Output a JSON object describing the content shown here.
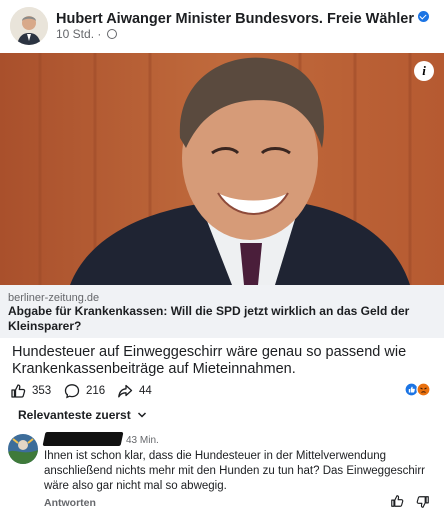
{
  "post": {
    "author": "Hubert Aiwanger Minister Bundesvors. Freie Wähler",
    "time": "10 Std.",
    "separator": "·",
    "audience_icon": "globe-icon",
    "verified_icon": "verified-badge-icon"
  },
  "link_preview": {
    "domain": "berliner-zeitung.de",
    "headline": "Abgabe für Krankenkassen: Will die SPD jetzt wirklich an das Geld der Kleinsparer?"
  },
  "post_text": "Hundesteuer auf Einweggeschirr wäre genau so passend wie Krankenkassenbeiträge auf Mieteinnahmen.",
  "actions": {
    "likes": "353",
    "comments": "216",
    "shares": "44"
  },
  "comments": {
    "sort_label": "Relevanteste zuerst",
    "items": [
      {
        "author_redacted": true,
        "time": "43 Min.",
        "text": "Ihnen ist schon klar, dass die Hundesteuer in der Mittelverwendung anschließend nichts mehr mit den Hunden zu tun hat? Das Einweggeschirr wäre also gar nicht mal so abwegig.",
        "reply_label": "Antworten"
      }
    ]
  },
  "colors": {
    "verified": "#1b74e4",
    "background_photo": "#b85e35",
    "link_box": "#f0f2f5",
    "muted_text": "#65676b"
  }
}
